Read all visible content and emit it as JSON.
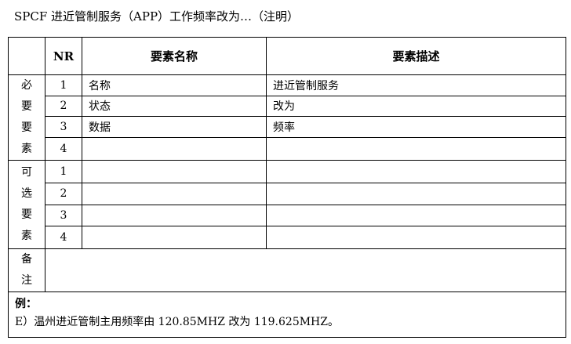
{
  "title": "SPCF 进近管制服务（APP）工作频率改为…（注明）",
  "header": {
    "nr": "NR",
    "name": "要素名称",
    "desc": "要素描述"
  },
  "mandatory": {
    "label": [
      "必",
      "要",
      "要",
      "素"
    ],
    "rows": [
      {
        "nr": "1",
        "name": "名称",
        "desc": "进近管制服务"
      },
      {
        "nr": "2",
        "name": "状态",
        "desc": "改为"
      },
      {
        "nr": "3",
        "name": "数据",
        "desc": "频率"
      },
      {
        "nr": "4",
        "name": "",
        "desc": ""
      }
    ]
  },
  "optional": {
    "label": [
      "可",
      "选",
      "要",
      "素"
    ],
    "rows": [
      {
        "nr": "1",
        "name": "",
        "desc": ""
      },
      {
        "nr": "2",
        "name": "",
        "desc": ""
      },
      {
        "nr": "3",
        "name": "",
        "desc": ""
      },
      {
        "nr": "4",
        "name": "",
        "desc": ""
      }
    ]
  },
  "remarks": {
    "label": [
      "备",
      "注"
    ],
    "value": ""
  },
  "example": {
    "heading": "例：",
    "text": "E）温州进近管制主用频率由 120.85MHZ 改为 119.625MHZ。"
  }
}
